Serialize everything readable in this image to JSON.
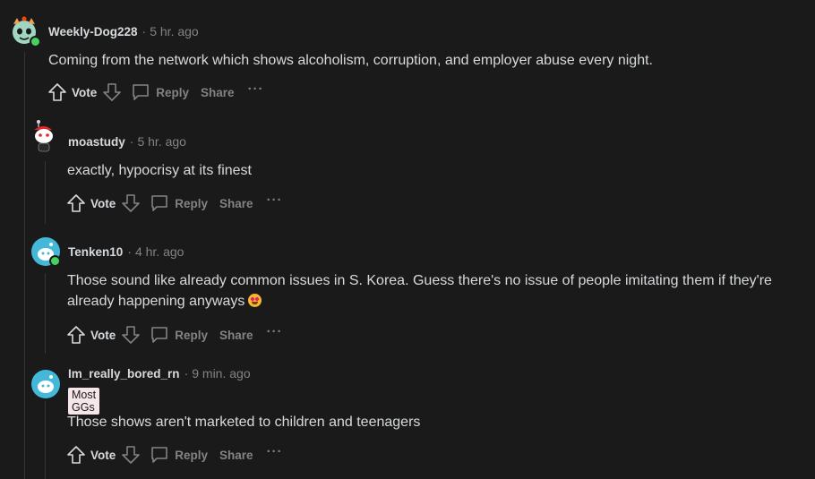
{
  "comments": [
    {
      "username": "Weekly-Dog228",
      "time": "5 hr. ago",
      "text_lines": [
        "Coming from the network which shows alcoholism, corruption, and employer abuse every night."
      ],
      "online": true
    },
    {
      "username": "moastudy",
      "time": "5 hr. ago",
      "text_lines": [
        "exactly, hypocrisy at its finest"
      ],
      "online": false
    },
    {
      "username": "Tenken10",
      "time": "4 hr. ago",
      "text_lines": [
        "Those sound like already common issues in S. Korea. Guess there's no issue of people imitating them if they're",
        "already happening anyways"
      ],
      "online": true,
      "emoji": "star-struck-emoji"
    },
    {
      "username": "Im_really_bored_rn",
      "time": "9 min. ago",
      "flair": "Most GGs",
      "text_lines": [
        "Those shows aren't marketed to children and teenagers"
      ],
      "online": false
    }
  ],
  "actions": {
    "vote": "Vote",
    "reply": "Reply",
    "share": "Share",
    "more": "···"
  },
  "separator": "·",
  "colors": {
    "background": "#1a1a1b",
    "text": "#d7dadc",
    "muted": "#818384",
    "online": "#46d160",
    "flair_bg": "#f6e6ea",
    "avatar_teal": "#44b8d8"
  },
  "icons": [
    "upvote-icon",
    "downvote-icon",
    "comment-icon",
    "more-icon"
  ]
}
